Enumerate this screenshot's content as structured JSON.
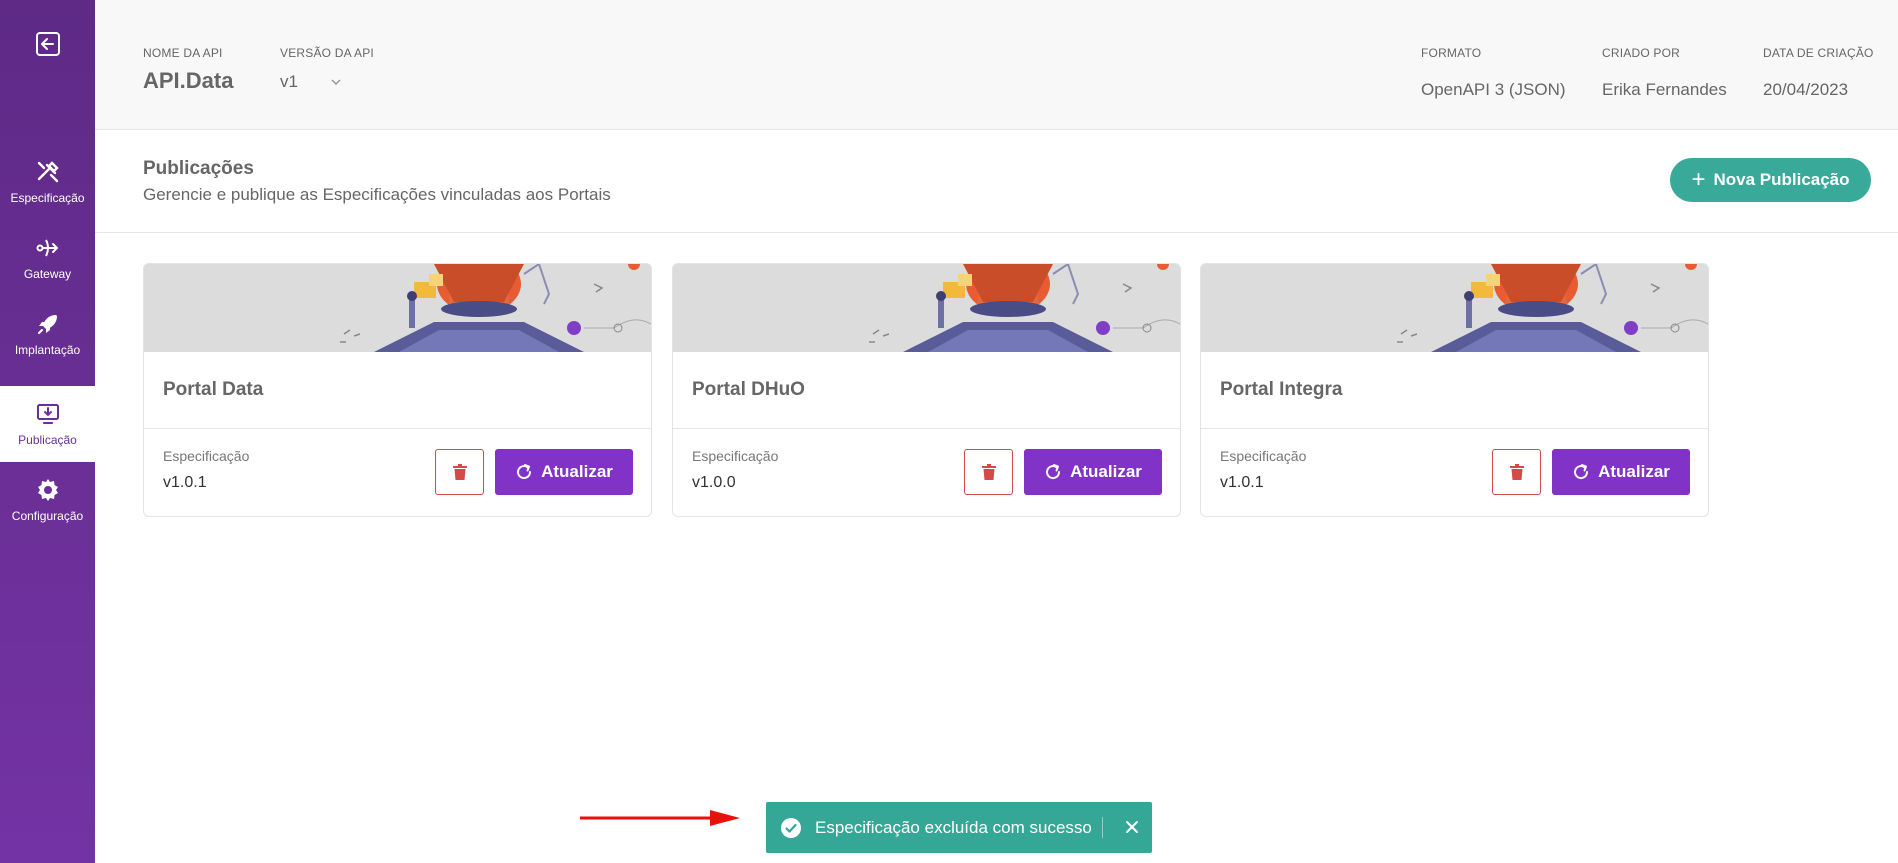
{
  "sidebar": {
    "exit_icon": "exit-icon",
    "items": [
      {
        "label": "Especificação",
        "icon": "tools-icon",
        "active": false
      },
      {
        "label": "Gateway",
        "icon": "gateway-icon",
        "active": false
      },
      {
        "label": "Implantação",
        "icon": "rocket-icon",
        "active": false
      },
      {
        "label": "Publicação",
        "icon": "monitor-download-icon",
        "active": true
      },
      {
        "label": "Configuração",
        "icon": "gear-icon",
        "active": false
      }
    ]
  },
  "header": {
    "api_name_label": "NOME DA API",
    "api_name": "API.Data",
    "version_label": "VERSÃO DA API",
    "version_value": "v1",
    "format_label": "FORMATO",
    "format_value": "OpenAPI 3 (JSON)",
    "created_by_label": "CRIADO POR",
    "created_by_value": "Erika Fernandes",
    "created_date_label": "DATA DE CRIAÇÃO",
    "created_date_value": "20/04/2023"
  },
  "section": {
    "title": "Publicações",
    "subtitle": "Gerencie e publique as Especificações vinculadas aos Portais",
    "new_button_label": "Nova Publicação"
  },
  "cards": [
    {
      "name": "Portal Data",
      "spec_label": "Especificação",
      "spec_version": "v1.0.1",
      "update_label": "Atualizar"
    },
    {
      "name": "Portal DHuO",
      "spec_label": "Especificação",
      "spec_version": "v1.0.0",
      "update_label": "Atualizar"
    },
    {
      "name": "Portal Integra",
      "spec_label": "Especificação",
      "spec_version": "v1.0.1",
      "update_label": "Atualizar"
    }
  ],
  "toast": {
    "message": "Especificação excluída com sucesso"
  },
  "colors": {
    "sidebar": "#6b2f97",
    "primary_button": "#8033c6",
    "accent_green": "#39a999",
    "delete_red": "#d24a4a",
    "arrow_red": "#e8120c"
  }
}
